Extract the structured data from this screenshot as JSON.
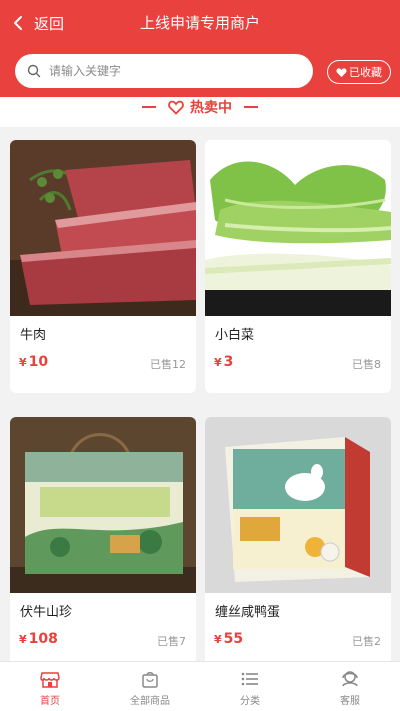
{
  "header": {
    "back_label": "返回",
    "title": "上线申请专用商户",
    "favorite_label": "已收藏"
  },
  "search": {
    "placeholder": "请输入关键字",
    "value": ""
  },
  "section": {
    "title": "热卖中"
  },
  "products": [
    {
      "name": "牛肉",
      "currency": "¥",
      "price": "10",
      "sold": "已售12",
      "image": "beef"
    },
    {
      "name": "小白菜",
      "currency": "¥",
      "price": "3",
      "sold": "已售8",
      "image": "bok-choy"
    },
    {
      "name": "伏牛山珍",
      "currency": "¥",
      "price": "108",
      "sold": "已售7",
      "image": "gift-box"
    },
    {
      "name": "缠丝咸鸭蛋",
      "currency": "¥",
      "price": "55",
      "sold": "已售2",
      "image": "duck-egg-box"
    }
  ],
  "tabbar": {
    "items": [
      {
        "label": "首页",
        "icon": "shop-icon",
        "active": true
      },
      {
        "label": "全部商品",
        "icon": "bag-icon",
        "active": false
      },
      {
        "label": "分类",
        "icon": "list-icon",
        "active": false
      },
      {
        "label": "客服",
        "icon": "headset-icon",
        "active": false
      }
    ]
  },
  "colors": {
    "brand": "#e9413d",
    "muted": "#999999"
  }
}
